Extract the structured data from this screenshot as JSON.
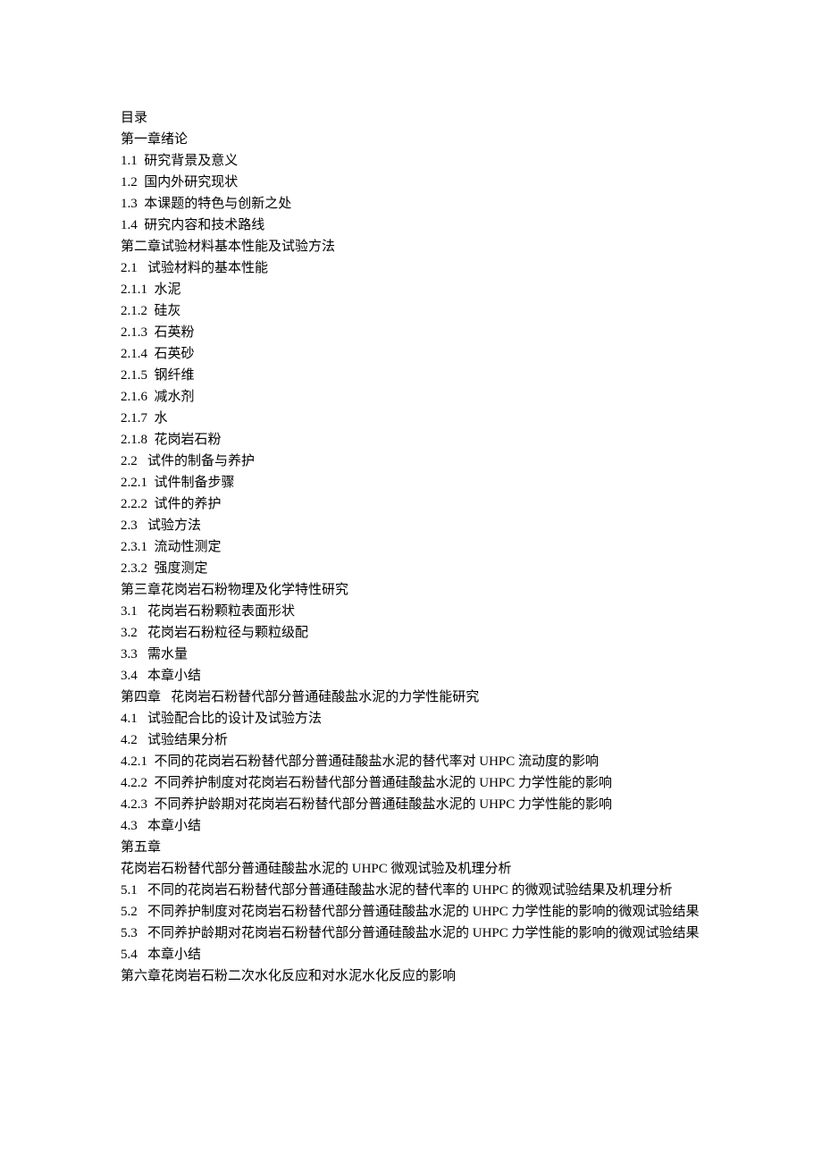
{
  "toc": {
    "title": "目录",
    "lines": [
      "第一章绪论",
      "1.1  研究背景及意义",
      "1.2  国内外研究现状",
      "1.3  本课题的特色与创新之处",
      "1.4  研究内容和技术路线",
      "第二章试验材料基本性能及试验方法",
      "2.1   试验材料的基本性能",
      "2.1.1  水泥",
      "2.1.2  硅灰",
      "2.1.3  石英粉",
      "2.1.4  石英砂",
      "2.1.5  钢纤维",
      "2.1.6  减水剂",
      "2.1.7  水",
      "2.1.8  花岗岩石粉",
      "2.2   试件的制备与养护",
      "2.2.1  试件制备步骤",
      "2.2.2  试件的养护",
      "2.3   试验方法",
      "2.3.1  流动性测定",
      "2.3.2  强度测定",
      "第三章花岗岩石粉物理及化学特性研究",
      "3.1   花岗岩石粉颗粒表面形状",
      "3.2   花岗岩石粉粒径与颗粒级配",
      "3.3   需水量",
      "3.4   本章小结",
      "第四章   花岗岩石粉替代部分普通硅酸盐水泥的力学性能研究",
      "4.1   试验配合比的设计及试验方法",
      "4.2   试验结果分析",
      "4.2.1  不同的花岗岩石粉替代部分普通硅酸盐水泥的替代率对 UHPC 流动度的影响",
      "4.2.2  不同养护制度对花岗岩石粉替代部分普通硅酸盐水泥的 UHPC 力学性能的影响",
      "4.2.3  不同养护龄期对花岗岩石粉替代部分普通硅酸盐水泥的 UHPC 力学性能的影响",
      "4.3   本章小结",
      "第五章",
      "花岗岩石粉替代部分普通硅酸盐水泥的 UHPC 微观试验及机理分析",
      "5.1   不同的花岗岩石粉替代部分普通硅酸盐水泥的替代率的 UHPC 的微观试验结果及机理分析",
      "5.2   不同养护制度对花岗岩石粉替代部分普通硅酸盐水泥的 UHPC 力学性能的影响的微观试验结果",
      "5.3   不同养护龄期对花岗岩石粉替代部分普通硅酸盐水泥的 UHPC 力学性能的影响的微观试验结果",
      "5.4   本章小结",
      "第六章花岗岩石粉二次水化反应和对水泥水化反应的影响"
    ]
  }
}
